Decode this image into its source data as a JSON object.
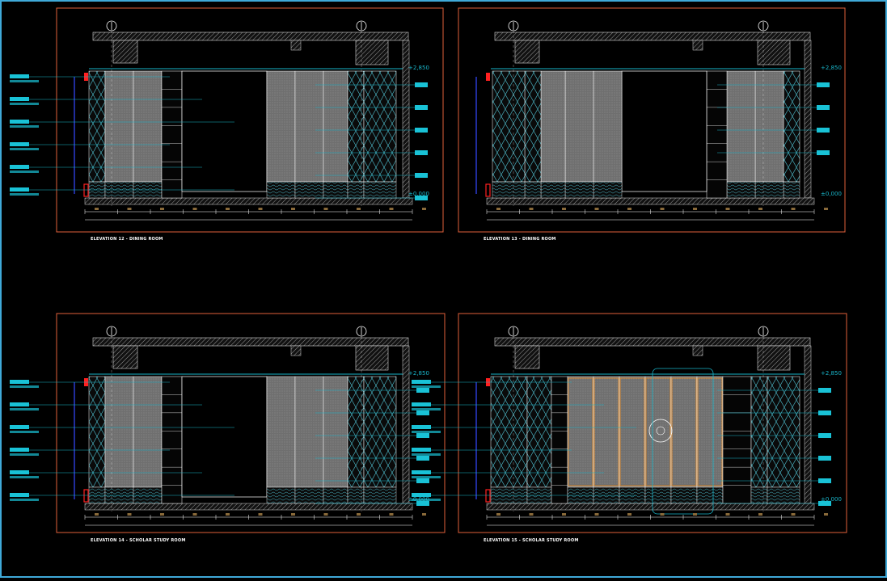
{
  "drawing": {
    "background": "#000000",
    "colors": {
      "frame": "#e0603a",
      "wall_hatch": "#d9d9d9",
      "panel_fill": "#7a7a7a",
      "leader": "#19b5c9",
      "tag": "#19c2d6",
      "red_marker": "#ff2020",
      "outline": "#ffffff",
      "highlight": "#e08a2a",
      "blue_glass": "#2a3ad0",
      "screen_border": "#3fa9d8"
    },
    "level_marks": {
      "top": "+2,850",
      "floor": "±0,000"
    },
    "panels": [
      {
        "id": "elevation-12",
        "title": "ELEVATION 12 -  DINING ROOM"
      },
      {
        "id": "elevation-13",
        "title": "ELEVATION 13 -  DINING ROOM"
      },
      {
        "id": "elevation-14",
        "title": "ELEVATION 14 - SCHOLAR STUDY ROOM"
      },
      {
        "id": "elevation-15",
        "title": "ELEVATION 15 - SCHOLAR STUDY ROOM"
      }
    ]
  }
}
